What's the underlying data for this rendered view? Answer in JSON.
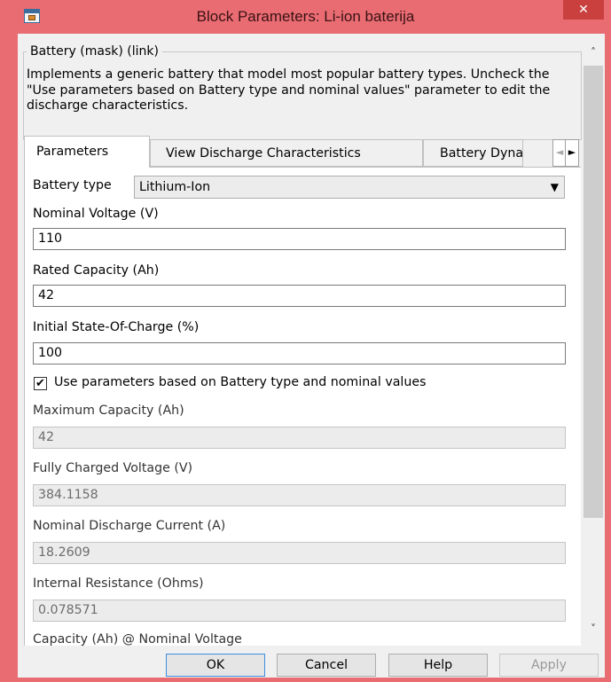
{
  "window": {
    "title": "Block Parameters: Li-ion baterija",
    "close_glyph": "✕",
    "icon": "simulink-block-icon"
  },
  "mask": {
    "group_title": "Battery (mask) (link)",
    "description": "Implements a generic battery that model most popular battery types. Uncheck the \"Use parameters based on Battery type and nominal values\" parameter to edit the discharge characteristics."
  },
  "tabs": [
    {
      "label": "Parameters",
      "active": true
    },
    {
      "label": "View Discharge Characteristics",
      "active": false
    },
    {
      "label": "Battery Dyna",
      "active": false
    }
  ],
  "tab_scroll": {
    "left": "◄",
    "right": "►"
  },
  "params": {
    "battery_type_label": "Battery type",
    "battery_type_value": "Lithium-Ion",
    "dropdown_arrow": "▼",
    "nominal_voltage_label": "Nominal Voltage (V)",
    "nominal_voltage_value": "110",
    "rated_capacity_label": "Rated Capacity (Ah)",
    "rated_capacity_value": "42",
    "initial_soc_label": "Initial State-Of-Charge (%)",
    "initial_soc_value": "100",
    "use_params_checked": true,
    "check_glyph": "✔",
    "use_params_label": "Use parameters based on Battery type and nominal values",
    "max_capacity_label": "Maximum Capacity (Ah)",
    "max_capacity_value": "42",
    "fully_charged_label": "Fully Charged Voltage (V)",
    "fully_charged_value": "384.1158",
    "nominal_discharge_label": "Nominal Discharge Current (A)",
    "nominal_discharge_value": "18.2609",
    "internal_resistance_label": "Internal Resistance (Ohms)",
    "internal_resistance_value": "0.078571",
    "capacity_nominal_label": "Capacity (Ah) @ Nominal Voltage"
  },
  "scrollbar": {
    "up": "˄",
    "down": "˅"
  },
  "buttons": {
    "ok": "OK",
    "cancel": "Cancel",
    "help": "Help",
    "apply": "Apply"
  },
  "colors": {
    "title_bar": "#e96c73",
    "close_button": "#c9403f",
    "dialog_bg": "#f0f0f0"
  }
}
